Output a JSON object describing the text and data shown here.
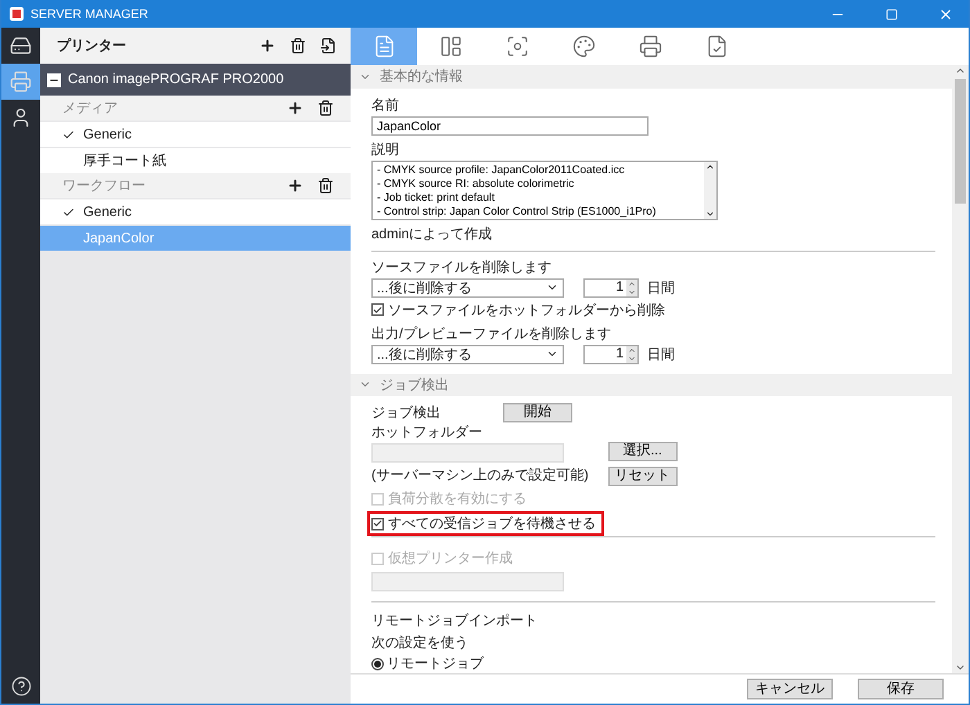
{
  "window": {
    "title": "SERVER MANAGER"
  },
  "rail": [
    {
      "kind": "drive",
      "selected": false
    },
    {
      "kind": "printer",
      "selected": true
    },
    {
      "kind": "user",
      "selected": false
    }
  ],
  "printers_panel": {
    "title": "プリンター",
    "printer": {
      "name": "Canon imagePROGRAF PRO2000",
      "expanded": true
    },
    "groups": [
      {
        "label": "メディア",
        "items": [
          {
            "label": "Generic",
            "checked": true,
            "selected": false
          },
          {
            "label": "厚手コート紙",
            "checked": false,
            "selected": false
          }
        ]
      },
      {
        "label": "ワークフロー",
        "items": [
          {
            "label": "Generic",
            "checked": true,
            "selected": false
          },
          {
            "label": "JapanColor",
            "checked": false,
            "selected": true
          }
        ]
      }
    ]
  },
  "tabs": [
    {
      "kind": "document",
      "selected": true
    },
    {
      "kind": "layout",
      "selected": false
    },
    {
      "kind": "focus",
      "selected": false
    },
    {
      "kind": "palette",
      "selected": false
    },
    {
      "kind": "printer",
      "selected": false
    },
    {
      "kind": "check",
      "selected": false
    }
  ],
  "basic_info": {
    "title": "基本的な情報",
    "expanded": true,
    "name_label": "名前",
    "name_value": "JapanColor",
    "description_label": "説明",
    "description_lines": [
      "- CMYK source profile: JapanColor2011Coated.icc",
      "- CMYK source RI: absolute colorimetric",
      "- Job ticket: print default",
      "- Control strip: Japan Color Control Strip (ES1000_i1Pro)"
    ],
    "created_by": "adminによって作成",
    "delete_source": {
      "label": "ソースファイルを削除します",
      "select_value": "...後に削除する",
      "days_value": "1",
      "days_unit": "日間"
    },
    "remove_from_hot_folder": {
      "label": "ソースファイルをホットフォルダーから削除",
      "checked": true,
      "disabled": false
    },
    "delete_output": {
      "label": "出力/プレビューファイルを削除します",
      "select_value": "...後に削除する",
      "days_value": "1",
      "days_unit": "日間"
    }
  },
  "job_detection": {
    "title": "ジョブ検出",
    "expanded": true,
    "detection_label": "ジョブ検出",
    "start_button": "開始",
    "hot_folder_label": "ホットフォルダー",
    "select_button": "選択...",
    "note": "(サーバーマシン上のみで設定可能)",
    "reset_button": "リセット",
    "load_balancing": {
      "label": "負荷分散を有効にする",
      "checked": false,
      "disabled": true
    },
    "hold_all_jobs": {
      "label": "すべての受信ジョブを待機させる",
      "checked": true,
      "disabled": false,
      "highlighted": true
    },
    "virtual_printer": {
      "label": "仮想プリンター作成",
      "checked": false,
      "disabled": true
    },
    "remote_import_label": "リモートジョブインポート",
    "use_settings_label": "次の設定を使う",
    "remote_job_radio": {
      "label": "リモートジョブ",
      "selected": true
    }
  },
  "footer_buttons": [
    "キャンセル",
    "保存"
  ]
}
